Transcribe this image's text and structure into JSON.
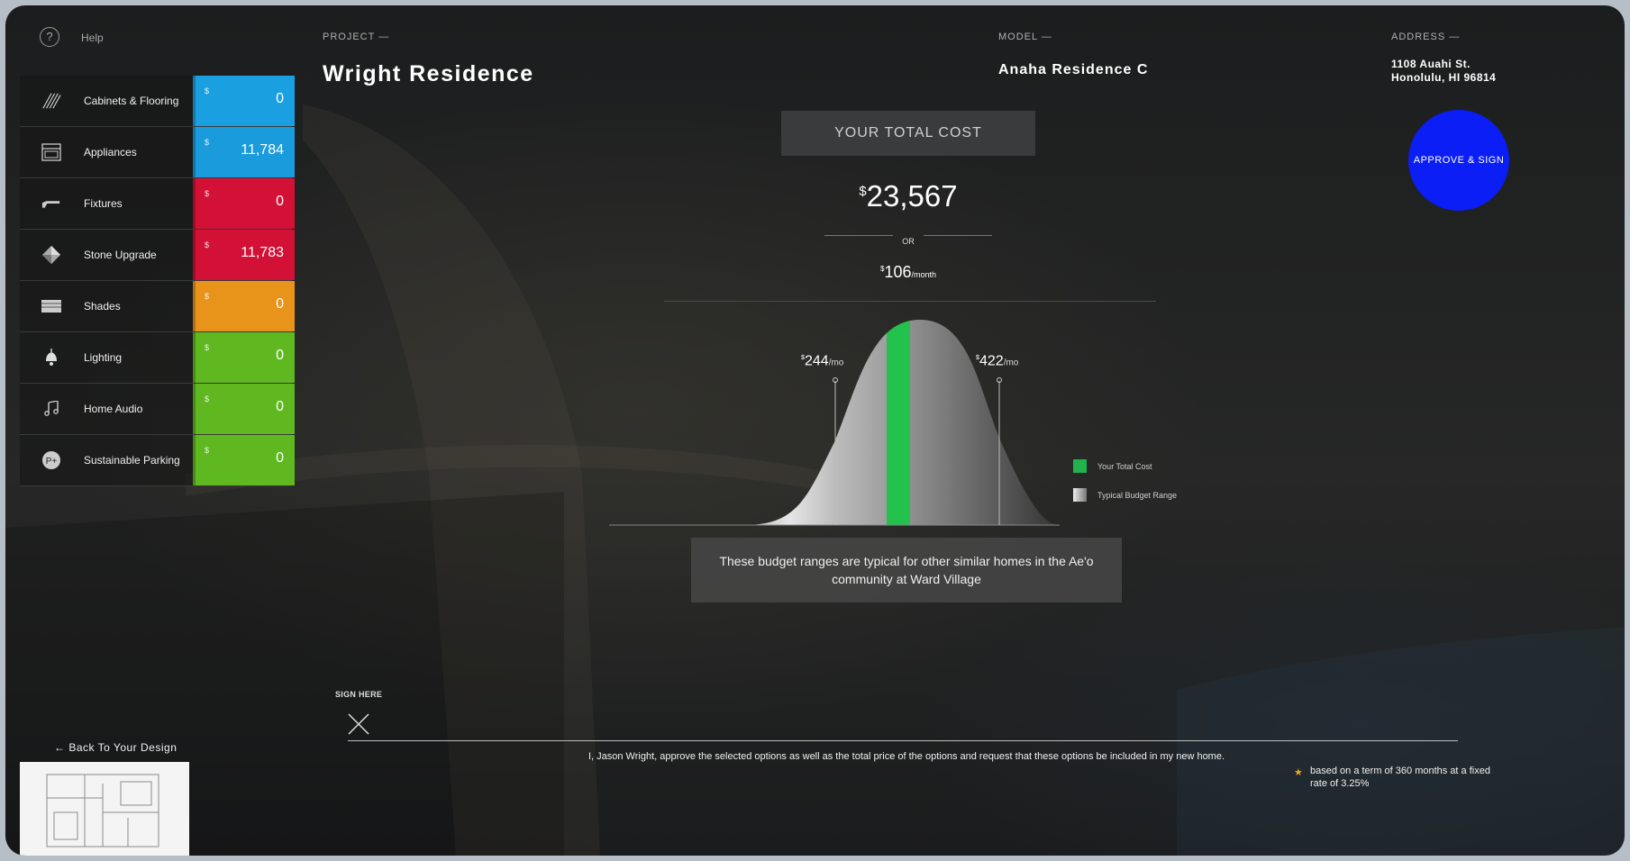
{
  "help": {
    "label": "Help",
    "icon": "question-circle-icon"
  },
  "sidebar": {
    "categories": [
      {
        "label": "Cabinets & Flooring",
        "currency": "$",
        "value": "0",
        "color": "#1aa0e0",
        "icon": "flooring-icon"
      },
      {
        "label": "Appliances",
        "currency": "$",
        "value": "11,784",
        "color": "#1a9cdc",
        "icon": "appliance-icon"
      },
      {
        "label": "Fixtures",
        "currency": "$",
        "value": "0",
        "color": "#d31036",
        "icon": "faucet-icon"
      },
      {
        "label": "Stone Upgrade",
        "currency": "$",
        "value": "11,783",
        "color": "#d31036",
        "icon": "stone-diamond-icon"
      },
      {
        "label": "Shades",
        "currency": "$",
        "value": "0",
        "color": "#e8941a",
        "icon": "shades-icon"
      },
      {
        "label": "Lighting",
        "currency": "$",
        "value": "0",
        "color": "#5fb820",
        "icon": "light-bulb-icon"
      },
      {
        "label": "Home Audio",
        "currency": "$",
        "value": "0",
        "color": "#5fb820",
        "icon": "music-note-icon"
      },
      {
        "label": "Sustainable Parking",
        "currency": "$",
        "value": "0",
        "color": "#5fb820",
        "icon": "ev-parking-icon"
      }
    ]
  },
  "header": {
    "project_label": "PROJECT —",
    "project_name": "Wright Residence",
    "model_label": "MODEL —",
    "model_name": "Anaha Residence C",
    "address_label": "ADDRESS —",
    "address_line1": "1108 Auahi St.",
    "address_line2": "Honolulu, HI 96814"
  },
  "approve_button": {
    "label": "APPROVE & SIGN",
    "color": "#0a1ef5"
  },
  "cost": {
    "box_label": "YOUR TOTAL COST",
    "currency": "$",
    "total": "23,567",
    "or_label": "OR",
    "monthly": "106",
    "monthly_unit": "/month"
  },
  "chart": {
    "low": {
      "currency": "$",
      "value": "244",
      "unit": "/mo"
    },
    "high": {
      "currency": "$",
      "value": "422",
      "unit": "/mo"
    },
    "legend": [
      {
        "label": "Your Total  Cost",
        "color": "#22b24c"
      },
      {
        "label": "Typical Budget Range",
        "color": "#cccccc"
      }
    ],
    "info": "These budget ranges are typical for other similar homes in the Ae'o community at Ward Village"
  },
  "signature": {
    "label": "SIGN HERE",
    "approval_text": "I, Jason Wright, approve the selected options as well as the total price of the options and request that these options be included in my new home."
  },
  "footer": {
    "back_label": "Back To Your Design",
    "footnote_symbol": "★",
    "footnote": "based on a term of 360 months at a fixed rate of 3.25%"
  }
}
